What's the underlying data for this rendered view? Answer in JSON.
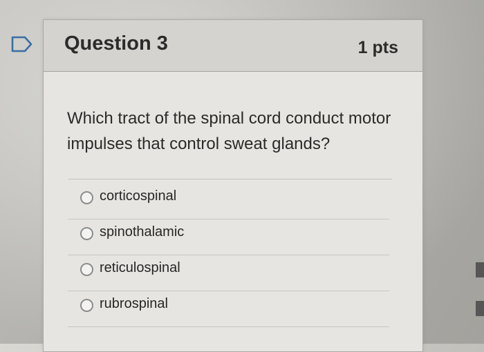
{
  "question": {
    "title": "Question 3",
    "points": "1 pts",
    "text": "Which tract of the spinal cord conduct motor impulses that control sweat glands?"
  },
  "answers": [
    {
      "label": "corticospinal"
    },
    {
      "label": "spinothalamic"
    },
    {
      "label": "reticulospinal"
    },
    {
      "label": "rubrospinal"
    }
  ],
  "icons": {
    "flag": "flag-icon",
    "radio": "radio-empty-icon"
  },
  "colors": {
    "card_bg": "#e6e5e1",
    "header_bg": "#d4d3cf",
    "flag_blue": "#3a6ea5"
  }
}
